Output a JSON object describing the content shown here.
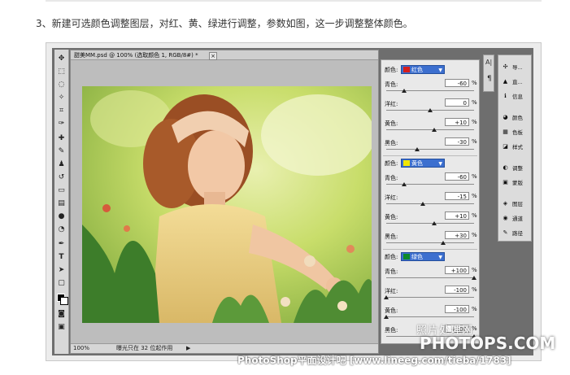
{
  "step_text": "3、新建可选颜色调整图层，对红、黄、绿进行调整，参数如图，这一步调整整体颜色。",
  "document": {
    "title": "甜美MM.psd @ 100% (选取颜色 1, RGB/8#) *",
    "close": "×",
    "zoom": "100%",
    "status": "曝光只在 32 位起作用",
    "status_arrow": "▶"
  },
  "adjustments": [
    {
      "label": "颜色:",
      "color_name": "红色",
      "chip_color": "#d61e1e",
      "params": [
        {
          "label": "青色:",
          "value": "-60",
          "unit": "%",
          "fraction": 0.2
        },
        {
          "label": "洋红:",
          "value": "0",
          "unit": "%",
          "fraction": 0.5
        },
        {
          "label": "黄色:",
          "value": "+10",
          "unit": "%",
          "fraction": 0.55
        },
        {
          "label": "黑色:",
          "value": "-30",
          "unit": "%",
          "fraction": 0.35
        }
      ]
    },
    {
      "label": "颜色:",
      "color_name": "黄色",
      "chip_color": "#f2e600",
      "params": [
        {
          "label": "青色:",
          "value": "-60",
          "unit": "%",
          "fraction": 0.2
        },
        {
          "label": "洋红:",
          "value": "-15",
          "unit": "%",
          "fraction": 0.42
        },
        {
          "label": "黄色:",
          "value": "+10",
          "unit": "%",
          "fraction": 0.55
        },
        {
          "label": "黑色:",
          "value": "+30",
          "unit": "%",
          "fraction": 0.65
        }
      ]
    },
    {
      "label": "颜色:",
      "color_name": "绿色",
      "chip_color": "#0e8a2a",
      "params": [
        {
          "label": "青色:",
          "value": "+100",
          "unit": "%",
          "fraction": 1.0
        },
        {
          "label": "洋红:",
          "value": "-100",
          "unit": "%",
          "fraction": 0.0
        },
        {
          "label": "黄色:",
          "value": "-100",
          "unit": "%",
          "fraction": 0.0
        },
        {
          "label": "黑色:",
          "value": "+100",
          "unit": "%",
          "fraction": 1.0
        }
      ]
    }
  ],
  "dock": [
    {
      "icon": "navigator-icon",
      "glyph": "✣",
      "label": "导..."
    },
    {
      "icon": "histogram-icon",
      "glyph": "▲",
      "label": "直..."
    },
    {
      "icon": "info-icon",
      "glyph": "ℹ",
      "label": "信息"
    },
    {
      "icon": "color-icon",
      "glyph": "◕",
      "label": "颜色"
    },
    {
      "icon": "swatches-icon",
      "glyph": "▦",
      "label": "色板"
    },
    {
      "icon": "styles-icon",
      "glyph": "◪",
      "label": "样式"
    },
    {
      "icon": "adjustments-icon",
      "glyph": "◐",
      "label": "调整"
    },
    {
      "icon": "masks-icon",
      "glyph": "▣",
      "label": "蒙版"
    },
    {
      "icon": "layers-icon",
      "glyph": "◈",
      "label": "图层"
    },
    {
      "icon": "channels-icon",
      "glyph": "◉",
      "label": "通道"
    },
    {
      "icon": "paths-icon",
      "glyph": "✎",
      "label": "路径"
    }
  ],
  "mini_panel": [
    "A|",
    "¶"
  ],
  "watermark": {
    "line1": "照片处理网",
    "line2": "PHOTOPS.COM",
    "line3": "PhotoShop平面设计吧 [www.lineeg.com/tieba/1783]"
  }
}
